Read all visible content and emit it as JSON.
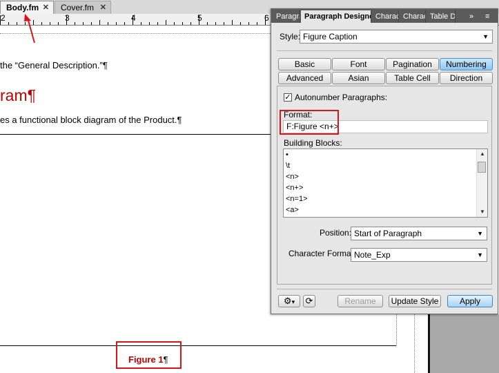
{
  "doc_tabs": [
    {
      "label": "Body.fm",
      "close": "✕"
    },
    {
      "label": "Cover.fm",
      "close": "✕"
    }
  ],
  "ruler": {
    "numbers": [
      "2",
      "3",
      "4",
      "5",
      "6"
    ]
  },
  "document": {
    "line1": "the “General Description.”¶",
    "heading": "ram¶",
    "line2": "es a functional block diagram of the Product.¶",
    "figure_caption": "Figure 1",
    "figure_pilcrow": "¶"
  },
  "panel": {
    "tabs": [
      "Paragra",
      "Paragraph Designer",
      "Charac",
      "Charac",
      "Table D"
    ],
    "overflow": "»",
    "menu": "≡",
    "style_label": "Style:",
    "style_value": "Figure Caption",
    "property_tabs_row1": [
      "Basic",
      "Font",
      "Pagination",
      "Numbering"
    ],
    "property_tabs_row2": [
      "Advanced",
      "Asian",
      "Table Cell",
      "Direction"
    ],
    "active_tab": "Numbering",
    "autonumber_label": "Autonumber Paragraphs:",
    "autonumber_checked": "✓",
    "format_label": "Format:",
    "format_value": "F:Figure <n+>",
    "building_blocks_label": "Building Blocks:",
    "building_blocks": [
      "•",
      "\\t",
      "<n>",
      "<n+>",
      "<n=1>",
      "<a>"
    ],
    "position_label": "Position:",
    "position_value": "Start of Paragraph",
    "char_format_label": "Character Format:",
    "char_format_value": "Note_Exp",
    "buttons": {
      "rename": "Rename",
      "update": "Update Style",
      "apply": "Apply"
    },
    "gear_icon": "⚙",
    "gear_arrow": "▾",
    "refresh_icon": "⟳"
  }
}
